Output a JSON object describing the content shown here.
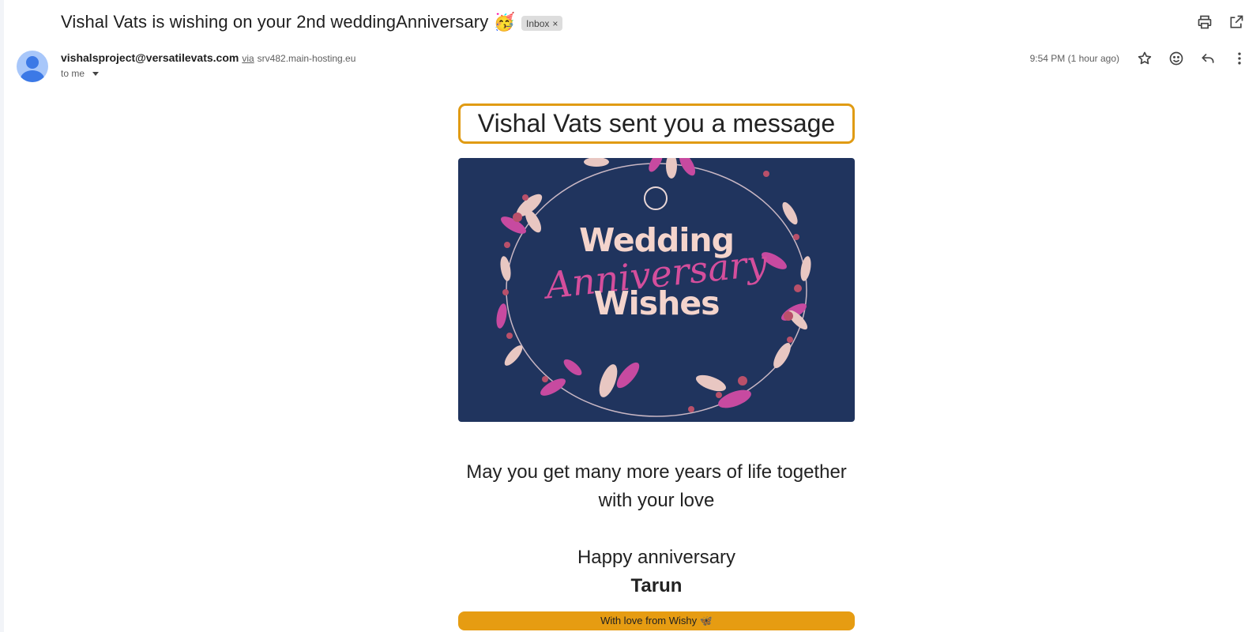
{
  "email": {
    "subject": "Vishal Vats is wishing on your 2nd weddingAnniversary 🥳",
    "label": "Inbox",
    "label_remove": "×",
    "sender_email": "vishalsproject@versatilevats.com",
    "via_text": "via",
    "via_host": "srv482.main-hosting.eu",
    "recipient": "to me",
    "timestamp": "9:54 PM (1 hour ago)"
  },
  "icons": {
    "print": "print-icon",
    "open_new_window": "open-in-new-window-icon",
    "star": "star-icon",
    "emoji": "emoji-reaction-icon",
    "reply": "reply-icon",
    "more": "more-vertical-icon",
    "avatar": "avatar-icon"
  },
  "body": {
    "header_box": "Vishal Vats sent you a message",
    "card_line1": "Wedding",
    "card_line2": "Anniversary",
    "card_line3": "Wishes",
    "message": "May you get many more years of life together with your love",
    "greeting": "Happy anniversary",
    "name": "Tarun",
    "footer": "With love from Wishy 🦋"
  },
  "colors": {
    "accent_orange": "#e69c12",
    "card_background": "#20345e",
    "card_pink": "#d44e9c",
    "card_cream": "#f4d4cc"
  }
}
